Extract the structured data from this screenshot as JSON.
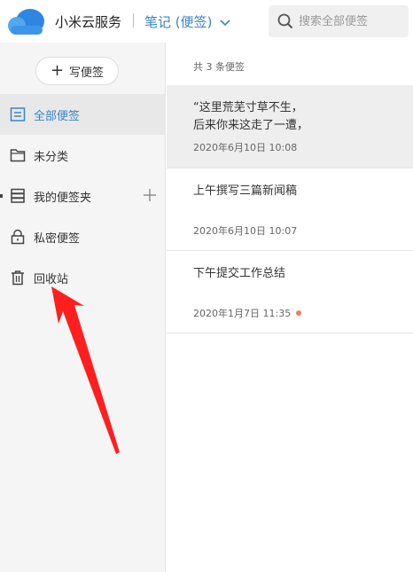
{
  "header": {
    "brand": "小米云服务",
    "notes_switch": "笔记 (便签)",
    "search_placeholder": "搜索全部便签"
  },
  "sidebar": {
    "write_button": "写便签",
    "items": [
      {
        "label": "全部便签",
        "icon": "all-notes-icon",
        "active": true
      },
      {
        "label": "未分类",
        "icon": "folder-icon",
        "active": false
      },
      {
        "label": "我的便签夹",
        "icon": "folders-icon",
        "active": false
      },
      {
        "label": "私密便签",
        "icon": "lock-icon",
        "active": false
      },
      {
        "label": "回收站",
        "icon": "trash-icon",
        "active": false
      }
    ]
  },
  "list": {
    "count_label": "共 3 条便签",
    "notes": [
      {
        "content": "“这里荒芜寸草不生，\n后来你来这走了一遭，",
        "time": "2020年6月10日 10:08",
        "selected": true,
        "unsynced": false
      },
      {
        "content": "上午撰写三篇新闻稿",
        "time": "2020年6月10日 10:07",
        "selected": false,
        "unsynced": false
      },
      {
        "content": "下午提交工作总结",
        "time": "2020年1月7日 11:35",
        "selected": false,
        "unsynced": true
      }
    ]
  },
  "colors": {
    "accent": "#3a84c8",
    "annotation_arrow": "#ff1f1f",
    "unsynced_dot": "#ee7c5a"
  }
}
